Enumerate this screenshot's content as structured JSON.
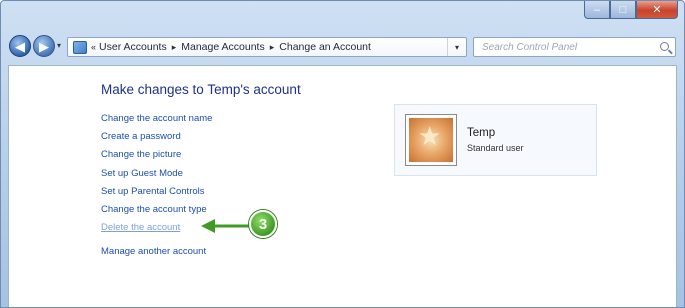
{
  "window": {
    "caption_buttons": {
      "minimize": "–",
      "maximize": "□",
      "close": "✕"
    }
  },
  "navbar": {
    "back": "◀",
    "forward": "▶",
    "history": "▾",
    "breadcrumb": [
      "User Accounts",
      "Manage Accounts",
      "Change an Account"
    ],
    "breadcrumb_lead": "«",
    "separator": "▸",
    "dropdown": "▾",
    "refresh": "↻",
    "search_placeholder": "Search Control Panel"
  },
  "main": {
    "heading": "Make changes to Temp's account",
    "links": [
      "Change the account name",
      "Create a password",
      "Change the picture",
      "Set up Guest Mode",
      "Set up Parental Controls",
      "Change the account type",
      "Delete the account"
    ],
    "manage_link": "Manage another account"
  },
  "account": {
    "name": "Temp",
    "type": "Standard user",
    "avatar_icon": "starfish-icon"
  },
  "callout": {
    "number": "3",
    "color": "#3f9b25"
  }
}
